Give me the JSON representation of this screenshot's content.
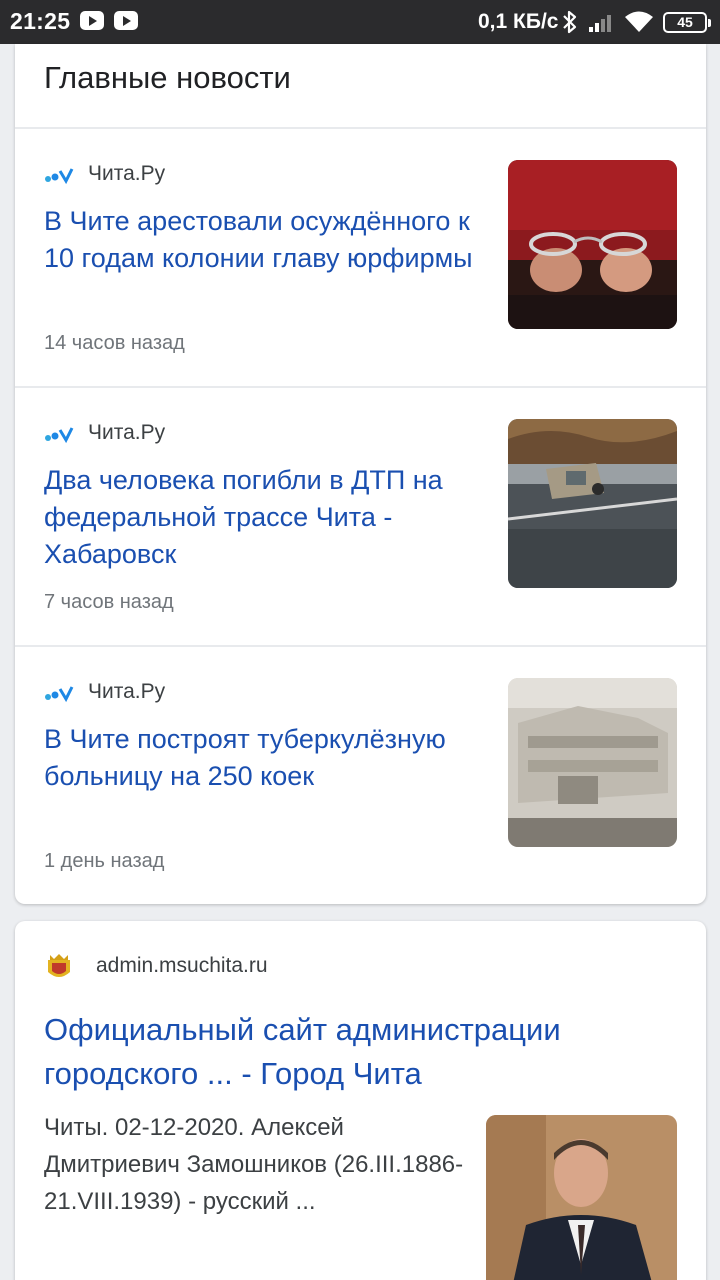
{
  "status_bar": {
    "time": "21:25",
    "speed": "0,1 КБ/с",
    "battery": "45",
    "icons": [
      "youtube-icon",
      "youtube-icon",
      "bluetooth-icon",
      "signal-icon",
      "wifi-icon",
      "battery-icon"
    ]
  },
  "top_stories": {
    "title": "Главные новости",
    "items": [
      {
        "source": "Чита.Ру",
        "headline": "В Чите арестовали осуждённого к 10 годам колонии главу юрфирмы",
        "time": "14 часов назад",
        "image": "handcuffs-photo"
      },
      {
        "source": "Чита.Ру",
        "headline": "Два человека погибли в ДТП на федеральной трассе Чита - Хабаровск",
        "time": "7 часов назад",
        "image": "car-crash-photo"
      },
      {
        "source": "Чита.Ру",
        "headline": "В Чите построят туберкулёзную больницу на 250 коек",
        "time": "1 день назад",
        "image": "hospital-model-photo"
      }
    ]
  },
  "result": {
    "domain": "admin.msuchita.ru",
    "title": "Официальный сайт администрации городского ... - Город Чита",
    "snippet": "Читы. 02-12-2020. Алексей Дмитриевич Замошников (26.III.1886-21.VIII.1939) - русский ...",
    "image": "official-portrait-photo"
  },
  "colors": {
    "link": "#1a4fb0",
    "status_bar": "#2b2b2d",
    "page_bg": "#eceef1"
  }
}
